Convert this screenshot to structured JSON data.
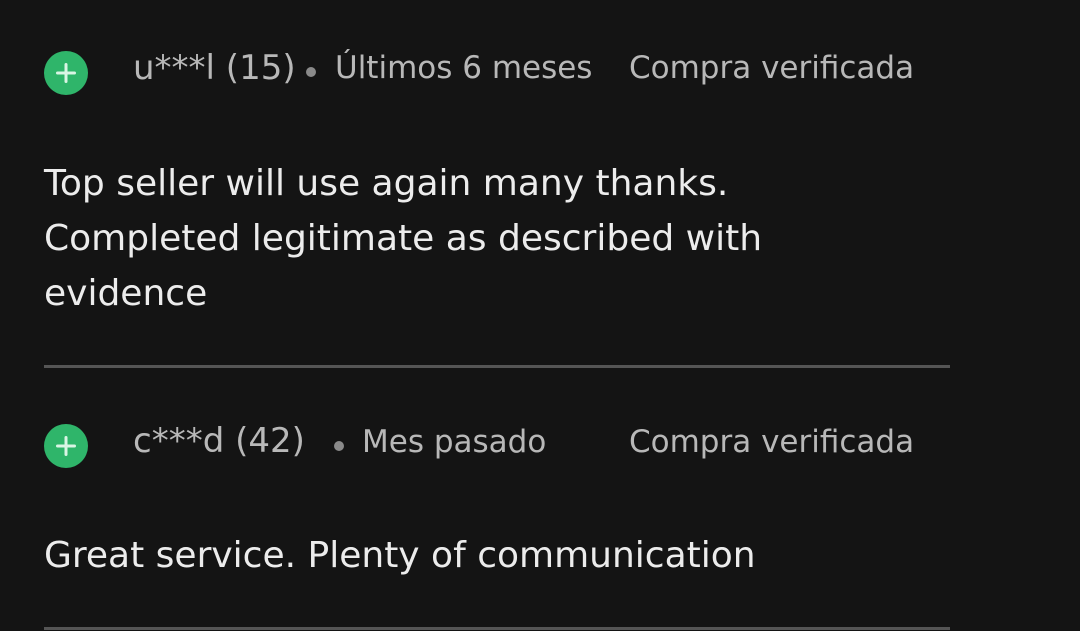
{
  "colors": {
    "background": "#141414",
    "accent": "#2fb56a",
    "meta_text": "#b8b8b8",
    "body_text": "#ececec",
    "divider": "#555555"
  },
  "reviews": [
    {
      "icon": "plus-icon",
      "username": "u***l (15)",
      "time": "Últimos 6 meses",
      "verified_label": "Compra verificada",
      "text": "Top seller will use again many thanks. Completed legitimate as described with evidence"
    },
    {
      "icon": "plus-icon",
      "username": "c***d (42)",
      "time": "Mes pasado",
      "verified_label": "Compra verificada",
      "text": "Great service. Plenty of communication"
    }
  ]
}
